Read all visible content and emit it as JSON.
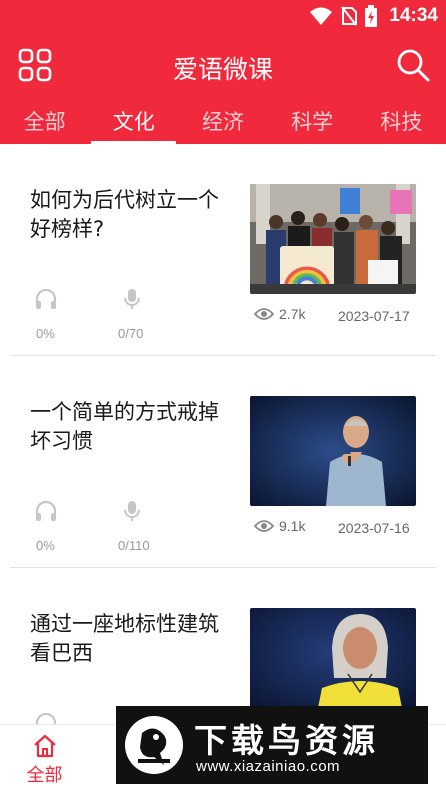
{
  "status_bar": {
    "time": "14:34",
    "icons": [
      "wifi-icon",
      "no-sim-icon",
      "battery-charging-icon"
    ]
  },
  "app_bar": {
    "title": "爱语微课",
    "left_icon": "apps-grid-icon",
    "right_icon": "search-icon"
  },
  "tabs": [
    {
      "label": "全部",
      "active": false
    },
    {
      "label": "文化",
      "active": true
    },
    {
      "label": "经济",
      "active": false
    },
    {
      "label": "科学",
      "active": false
    },
    {
      "label": "科技",
      "active": false
    }
  ],
  "cards": [
    {
      "title": "如何为后代树立一个好榜样?",
      "listen": "0%",
      "record": "0/70",
      "views": "2.7k",
      "date": "2023-07-17"
    },
    {
      "title": "一个简单的方式戒掉坏习惯",
      "listen": "0%",
      "record": "0/110",
      "views": "9.1k",
      "date": "2023-07-16"
    },
    {
      "title": "通过一座地标性建筑看巴西"
    }
  ],
  "bottom_nav": [
    {
      "label": "全部",
      "icon": "home-icon",
      "active": true
    },
    {
      "label": "",
      "icon": "",
      "active": false
    },
    {
      "label": "",
      "icon": "",
      "active": false
    },
    {
      "label": "",
      "icon": "",
      "active": false
    },
    {
      "label": "",
      "icon": "",
      "active": false
    }
  ],
  "watermark": {
    "title": "下载鸟资源",
    "url": "www.xiazainiao.com"
  },
  "colors": {
    "brand_red": "#f0293d",
    "text_dark": "#1a1a1a",
    "text_muted": "#9a9a9a"
  }
}
